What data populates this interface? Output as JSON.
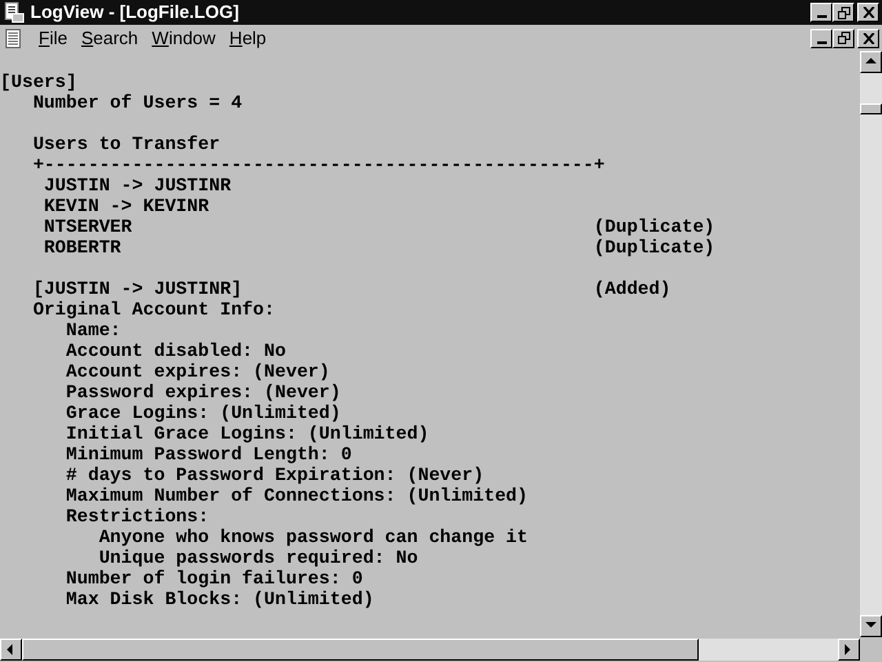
{
  "window": {
    "title": "LogView - [LogFile.LOG]"
  },
  "menu": [
    {
      "label": "File"
    },
    {
      "label": "Search"
    },
    {
      "label": "Window"
    },
    {
      "label": "Help"
    }
  ],
  "log_lines": [
    {
      "text": "[Users]"
    },
    {
      "text": "   Number of Users = 4"
    },
    {
      "text": "   Users to Transfer",
      "gap_before": true
    },
    {
      "text": "   +--------------------------------------------------+"
    },
    {
      "text": "    JUSTIN -> JUSTINR"
    },
    {
      "text": "    KEVIN -> KEVINR"
    },
    {
      "text": "    NTSERVER",
      "note": "(Duplicate)"
    },
    {
      "text": "    ROBERTR",
      "note": "(Duplicate)"
    },
    {
      "text": "   [JUSTIN -> JUSTINR]",
      "note": "(Added)",
      "gap_before": true
    },
    {
      "text": "   Original Account Info:"
    },
    {
      "text": "      Name:"
    },
    {
      "text": "      Account disabled: No"
    },
    {
      "text": "      Account expires: (Never)"
    },
    {
      "text": "      Password expires: (Never)"
    },
    {
      "text": "      Grace Logins: (Unlimited)"
    },
    {
      "text": "      Initial Grace Logins: (Unlimited)"
    },
    {
      "text": "      Minimum Password Length: 0"
    },
    {
      "text": "      # days to Password Expiration: (Never)"
    },
    {
      "text": "      Maximum Number of Connections: (Unlimited)"
    },
    {
      "text": "      Restrictions:"
    },
    {
      "text": "         Anyone who knows password can change it"
    },
    {
      "text": "         Unique passwords required: No"
    },
    {
      "text": "      Number of login failures: 0"
    },
    {
      "text": "      Max Disk Blocks: (Unlimited)"
    }
  ]
}
